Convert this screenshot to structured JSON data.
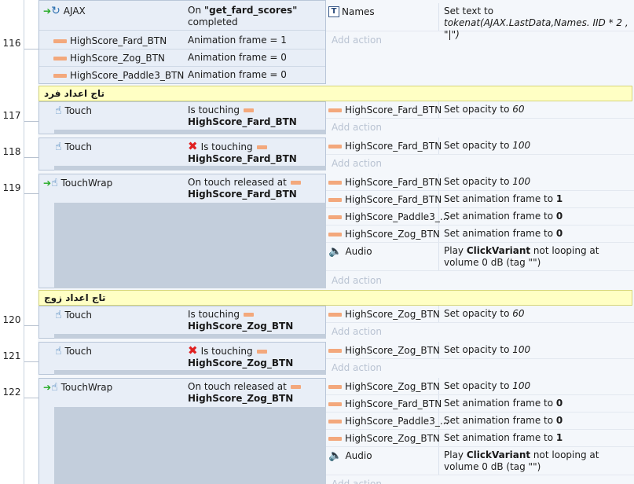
{
  "line_numbers": [
    "116",
    "117",
    "118",
    "119",
    "120",
    "121",
    "122"
  ],
  "comments": [
    {
      "text": "تاج اعداد فرد"
    },
    {
      "text": "تاج اعداد زوج"
    }
  ],
  "event116": {
    "cond0": {
      "obj": "AJAX",
      "text_pre": "On ",
      "text_bold": "\"get_fard_scores\"",
      "text_post": "completed"
    },
    "cond1": {
      "obj": "HighScore_Fard_BTN",
      "text": "Animation frame = 1"
    },
    "cond2": {
      "obj": "HighScore_Zog_BTN",
      "text": "Animation frame = 0"
    },
    "cond3": {
      "obj": "HighScore_Paddle3_BTN",
      "text": "Animation frame = 0"
    },
    "action0": {
      "obj": "Names",
      "text_pre": "Set text to ",
      "text_italic": "tokenat(AJAX.LastData,Names. IID * 2 , \"|\")"
    },
    "add_action": "Add action"
  },
  "event117": {
    "cond": {
      "obj": "Touch",
      "line1": "Is touching",
      "line2": "HighScore_Fard_BTN"
    },
    "action0": {
      "obj": "HighScore_Fard_BTN",
      "text_pre": "Set opacity to ",
      "text_italic": "60"
    },
    "add_action": "Add action"
  },
  "event118": {
    "cond": {
      "obj": "Touch",
      "line1": "Is touching",
      "line2": "HighScore_Fard_BTN"
    },
    "action0": {
      "obj": "HighScore_Fard_BTN",
      "text_pre": "Set opacity to ",
      "text_italic": "100"
    },
    "add_action": "Add action"
  },
  "event119": {
    "cond": {
      "obj": "TouchWrap",
      "line1": "On touch released at",
      "line2": "HighScore_Fard_BTN"
    },
    "actions": [
      {
        "obj": "HighScore_Fard_BTN",
        "text_pre": "Set opacity to ",
        "text_em": "100"
      },
      {
        "obj": "HighScore_Fard_BTN",
        "text_pre": "Set animation frame to ",
        "text_bold": "1"
      },
      {
        "obj": "HighScore_Paddle3_...",
        "text_pre": "Set animation frame to ",
        "text_bold": "0"
      },
      {
        "obj": "HighScore_Zog_BTN",
        "text_pre": "Set animation frame to ",
        "text_bold": "0"
      }
    ],
    "audio": {
      "obj": "Audio",
      "text_pre": "Play ",
      "text_bold": "ClickVariant",
      "text_post": " not looping at volume 0 dB (tag \"\")"
    },
    "add_action": "Add action"
  },
  "event120": {
    "cond": {
      "obj": "Touch",
      "line1": "Is touching",
      "line2": "HighScore_Zog_BTN"
    },
    "action0": {
      "obj": "HighScore_Zog_BTN",
      "text_pre": "Set opacity to ",
      "text_italic": "60"
    },
    "add_action": "Add action"
  },
  "event121": {
    "cond": {
      "obj": "Touch",
      "line1": "Is touching",
      "line2": "HighScore_Zog_BTN"
    },
    "action0": {
      "obj": "HighScore_Zog_BTN",
      "text_pre": "Set opacity to ",
      "text_italic": "100"
    },
    "add_action": "Add action"
  },
  "event122": {
    "cond": {
      "obj": "TouchWrap",
      "line1": "On touch released at",
      "line2": "HighScore_Zog_BTN"
    },
    "actions": [
      {
        "obj": "HighScore_Zog_BTN",
        "text_pre": "Set opacity to ",
        "text_em": "100"
      },
      {
        "obj": "HighScore_Fard_BTN",
        "text_pre": "Set animation frame to ",
        "text_bold": "0"
      },
      {
        "obj": "HighScore_Paddle3_...",
        "text_pre": "Set animation frame to ",
        "text_bold": "0"
      },
      {
        "obj": "HighScore_Zog_BTN",
        "text_pre": "Set animation frame to ",
        "text_bold": "1"
      }
    ],
    "audio": {
      "obj": "Audio",
      "text_pre": "Play ",
      "text_bold": "ClickVariant",
      "text_post": " not looping at volume 0 dB (tag \"\")"
    },
    "add_action": "Add action"
  }
}
